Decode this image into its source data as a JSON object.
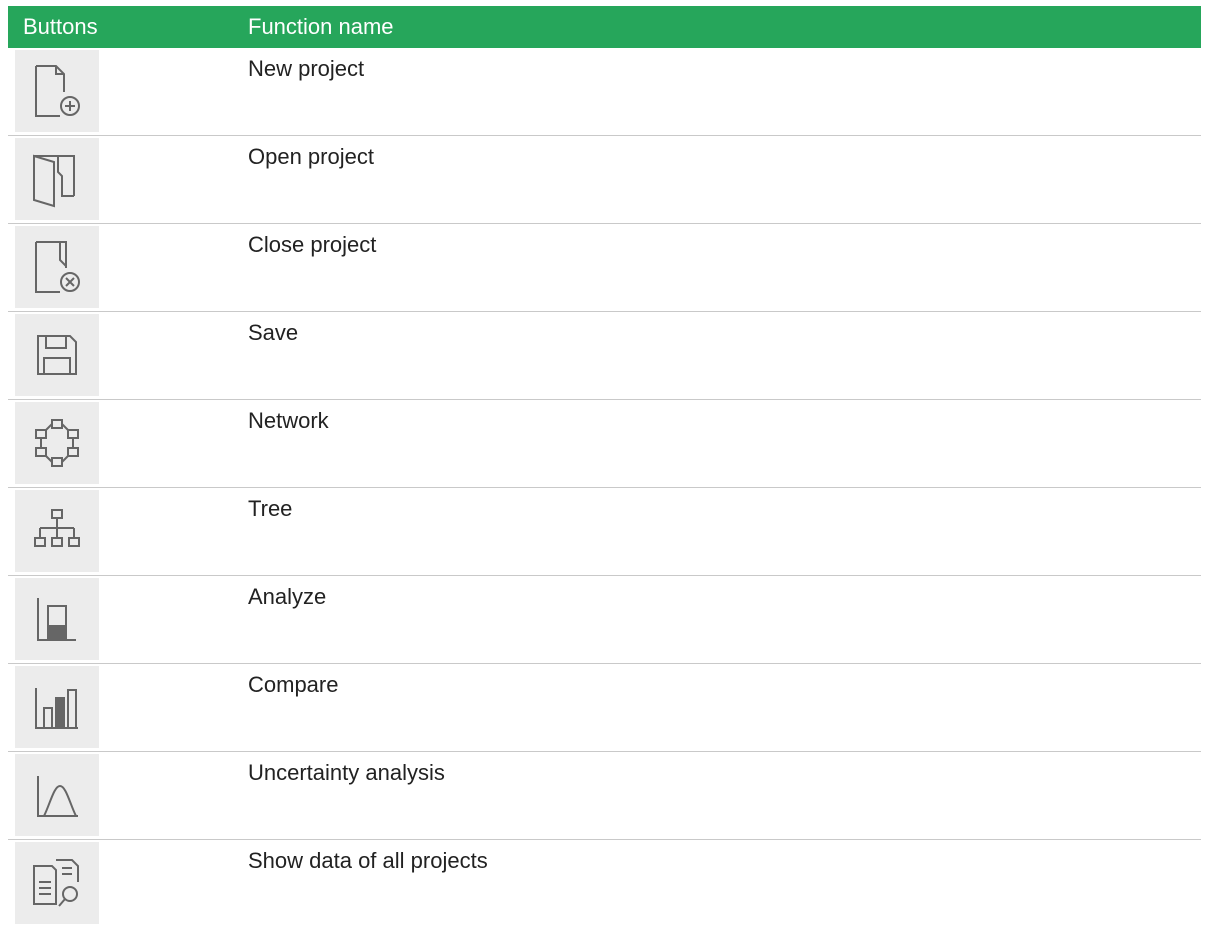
{
  "table": {
    "headers": {
      "buttons": "Buttons",
      "function_name": "Function name"
    },
    "header_color": "#26a65b",
    "rows": [
      {
        "icon": "new-project-icon",
        "label": "New project"
      },
      {
        "icon": "open-project-icon",
        "label": "Open project"
      },
      {
        "icon": "close-project-icon",
        "label": "Close project"
      },
      {
        "icon": "save-icon",
        "label": "Save"
      },
      {
        "icon": "network-icon",
        "label": "Network"
      },
      {
        "icon": "tree-icon",
        "label": "Tree"
      },
      {
        "icon": "analyze-icon",
        "label": "Analyze"
      },
      {
        "icon": "compare-icon",
        "label": "Compare"
      },
      {
        "icon": "uncertainty-analysis-icon",
        "label": "Uncertainty analysis"
      },
      {
        "icon": "show-data-all-projects-icon",
        "label": "Show data of all projects"
      }
    ]
  }
}
